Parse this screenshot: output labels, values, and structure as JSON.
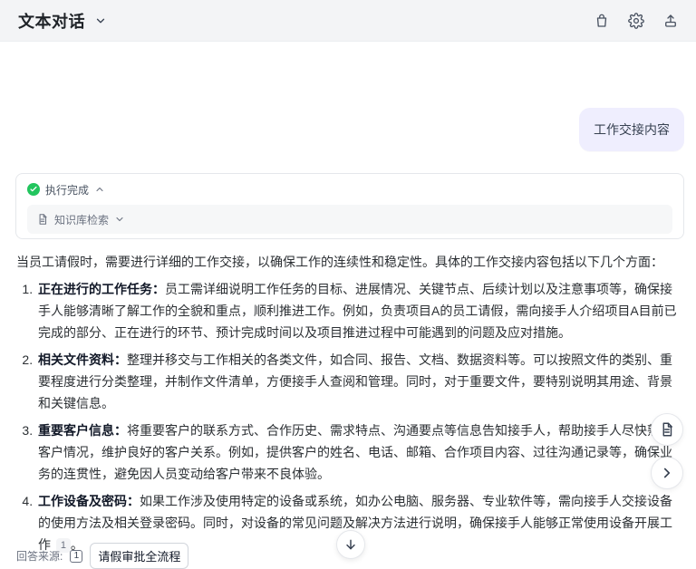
{
  "header": {
    "title": "文本对话",
    "icons": [
      "chevron-down-icon",
      "bag-icon",
      "gear-icon",
      "share-icon"
    ]
  },
  "chat": {
    "user_message": "工作交接内容",
    "status": {
      "label": "执行完成",
      "kb_label": "知识库检索"
    },
    "answer": {
      "intro": "当员工请假时，需要进行详细的工作交接，以确保工作的连续性和稳定性。具体的工作交接内容包括以下几个方面：",
      "items": [
        {
          "title": "正在进行的工作任务：",
          "text": "员工需详细说明工作任务的目标、进展情况、关键节点、后续计划以及注意事项等，确保接手人能够清晰了解工作的全貌和重点，顺利推进工作。例如，负责项目A的员工请假，需向接手人介绍项目A目前已完成的部分、正在进行的环节、预计完成时间以及项目推进过程中可能遇到的问题及应对措施。"
        },
        {
          "title": "相关文件资料：",
          "text": "整理并移交与工作相关的各类文件，如合同、报告、文档、数据资料等。可以按照文件的类别、重要程度进行分类整理，并制作文件清单，方便接手人查阅和管理。同时，对于重要文件，要特别说明其用途、背景和关键信息。"
        },
        {
          "title": "重要客户信息：",
          "text": "将重要客户的联系方式、合作历史、需求特点、沟通要点等信息告知接手人，帮助接手人尽快熟悉客户情况，维护良好的客户关系。例如，提供客户的姓名、电话、邮箱、合作项目内容、过往沟通记录等，确保业务的连贯性，避免因人员变动给客户带来不良体验。"
        },
        {
          "title": "工作设备及密码：",
          "text": "如果工作涉及使用特定的设备或系统，如办公电脑、服务器、专业软件等，需向接手人交接设备的使用方法及相关登录密码。同时，对设备的常见问题及解决方法进行说明，确保接手人能够正常使用设备开展工作",
          "citation": "1",
          "end": "。"
        }
      ]
    },
    "sources": {
      "label": "回答来源:",
      "chip": "请假审批全流程",
      "index": "1"
    }
  },
  "colors": {
    "bubble_bg": "#efeefe",
    "topbar_bg": "#f3f4f6",
    "success": "#22c55e"
  }
}
